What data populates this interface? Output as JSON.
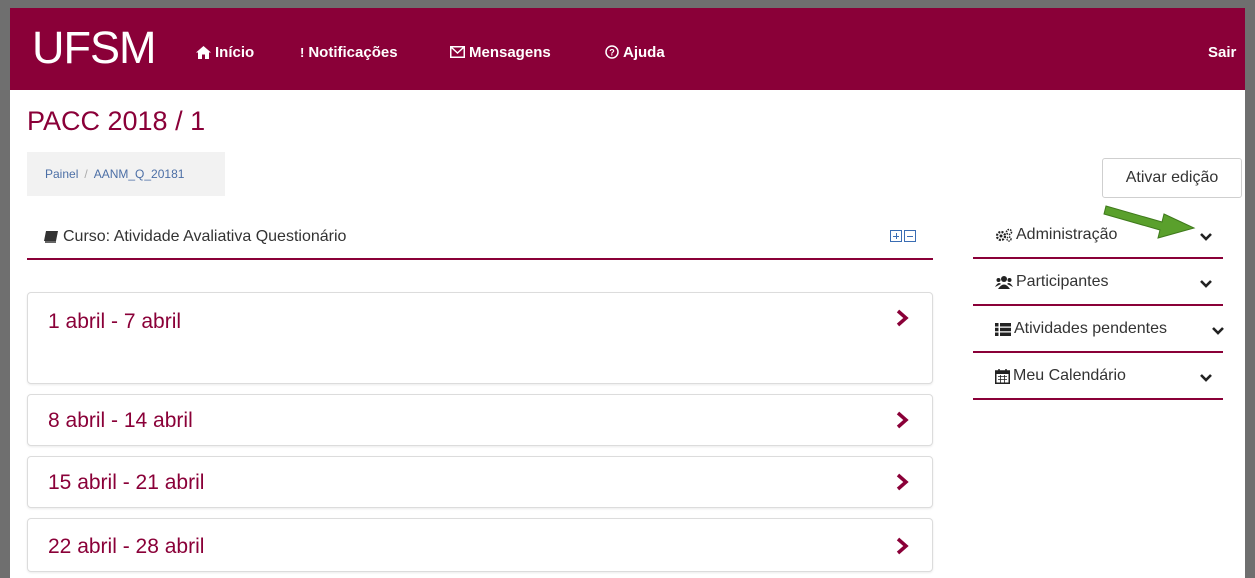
{
  "navbar": {
    "logo": "UFSM",
    "items": [
      {
        "icon": "home-icon",
        "glyph": "⌂",
        "label": "Início"
      },
      {
        "icon": "exclamation-icon",
        "glyph": "!",
        "label": "Notificações"
      },
      {
        "icon": "envelope-icon",
        "glyph": "✉",
        "label": "Mensagens"
      },
      {
        "icon": "help-circle-icon",
        "glyph": "?",
        "label": "Ajuda"
      }
    ],
    "logout": "Sair"
  },
  "page": {
    "title": "PACC 2018 / 1",
    "breadcrumb": [
      "Painel",
      "AANM_Q_20181"
    ],
    "edit_button": "Ativar edição"
  },
  "course": {
    "title": "Curso: Atividade Avaliativa Questionário",
    "weeks": [
      "1 abril - 7 abril",
      "8 abril - 14 abril",
      "15 abril - 21 abril",
      "22 abril - 28 abril"
    ]
  },
  "blocks": [
    {
      "icon": "cogs-icon",
      "label": "Administração"
    },
    {
      "icon": "users-icon",
      "label": "Participantes"
    },
    {
      "icon": "list-icon",
      "label": "Atividades pendentes"
    },
    {
      "icon": "calendar-icon",
      "label": "Meu Calendário"
    }
  ],
  "colors": {
    "brand": "#8a0038",
    "arrow": "#5aa02c"
  }
}
